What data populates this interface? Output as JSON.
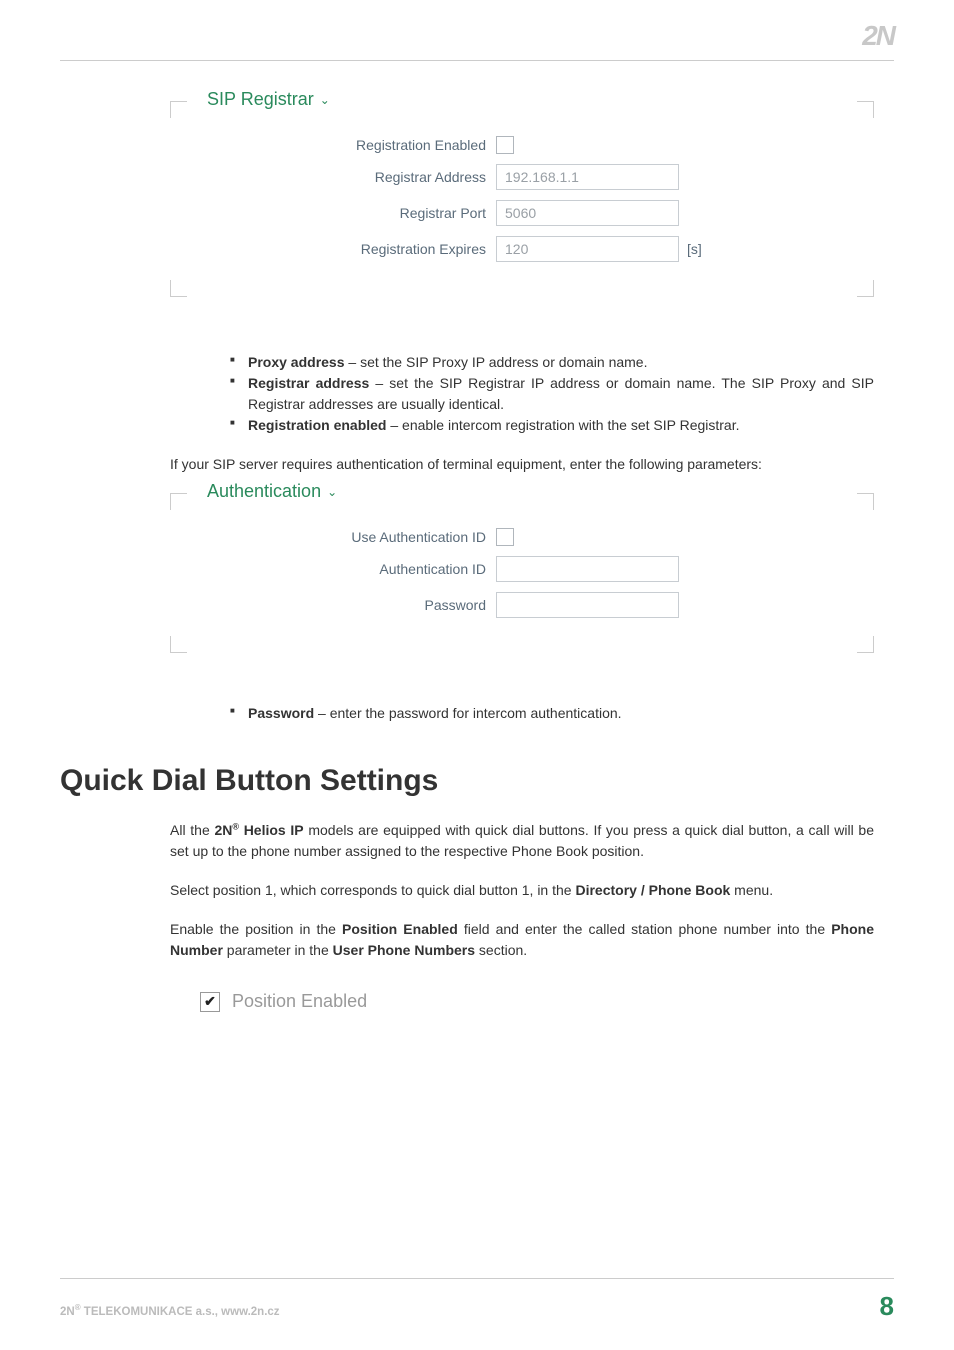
{
  "header": {
    "logo": "2N"
  },
  "sip_registrar": {
    "title": "SIP Registrar",
    "rows": {
      "reg_enabled_label": "Registration Enabled",
      "addr_label": "Registrar Address",
      "addr_value": "192.168.1.1",
      "port_label": "Registrar Port",
      "port_value": "5060",
      "expires_label": "Registration Expires",
      "expires_value": "120",
      "expires_unit": "[s]"
    }
  },
  "bullets1": {
    "b1_bold": "Proxy address",
    "b1_rest": " – set the SIP Proxy IP address or domain name.",
    "b2_bold": "Registrar address",
    "b2_rest": " – set the SIP Registrar IP address or domain name. The SIP Proxy and SIP Registrar addresses are usually identical.",
    "b3_bold": "Registration enabled",
    "b3_rest": " – enable intercom registration with the set SIP Registrar."
  },
  "para1": "If your SIP server requires authentication of terminal equipment, enter the following parameters:",
  "authentication": {
    "title": "Authentication",
    "rows": {
      "use_auth_label": "Use Authentication ID",
      "auth_id_label": "Authentication ID",
      "password_label": "Password"
    }
  },
  "bullets2": {
    "b1_bold": "Password",
    "b1_rest": " – enter the password for intercom authentication."
  },
  "heading": "Quick Dial Button Settings",
  "quick_dial": {
    "p1_a": "All the ",
    "p1_b": "2N",
    "p1_c": " Helios IP",
    "p1_d": " models are equipped with quick dial buttons. If you press a quick dial button, a call will be set up to the phone number assigned to the respective Phone Book position.",
    "p2_a": "Select position 1, which corresponds to quick dial button 1, in the ",
    "p2_b": "Directory / Phone Book",
    "p2_c": " menu.",
    "p3_a": "Enable the position in the ",
    "p3_b": "Position Enabled",
    "p3_c": " field and enter the called station phone number into the ",
    "p3_d": "Phone Number",
    "p3_e": " parameter in the ",
    "p3_f": "User Phone Numbers",
    "p3_g": " section."
  },
  "position_enabled_label": "Position Enabled",
  "footer": {
    "company_a": "2N",
    "company_b": " TELEKOMUNIKACE a.s., www.2n.cz",
    "page": "8"
  }
}
